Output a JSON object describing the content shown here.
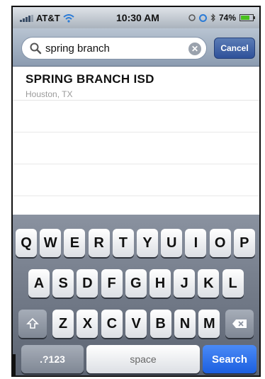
{
  "status_bar": {
    "carrier": "AT&T",
    "time": "10:30 AM",
    "battery": "74%",
    "battery_level": 0.74
  },
  "search": {
    "query": "spring branch",
    "cancel_label": "Cancel"
  },
  "results": [
    {
      "title": "SPRING BRANCH ISD",
      "subtitle": "Houston, TX"
    }
  ],
  "keyboard": {
    "row1": [
      "Q",
      "W",
      "E",
      "R",
      "T",
      "Y",
      "U",
      "I",
      "O",
      "P"
    ],
    "row2": [
      "A",
      "S",
      "D",
      "F",
      "G",
      "H",
      "J",
      "K",
      "L"
    ],
    "row3": [
      "Z",
      "X",
      "C",
      "V",
      "B",
      "N",
      "M"
    ],
    "numbers_label": ".?123",
    "space_label": "space",
    "search_label": "Search"
  },
  "colors": {
    "search_key": "#1c5fe0",
    "cancel_button": "#2f519a",
    "battery_fill": "#49c01d"
  },
  "icons": {
    "wifi": "wifi-icon",
    "battery": "battery-icon",
    "search": "magnifier-icon",
    "clear": "clear-icon",
    "shift": "shift-icon",
    "backspace": "backspace-icon"
  }
}
